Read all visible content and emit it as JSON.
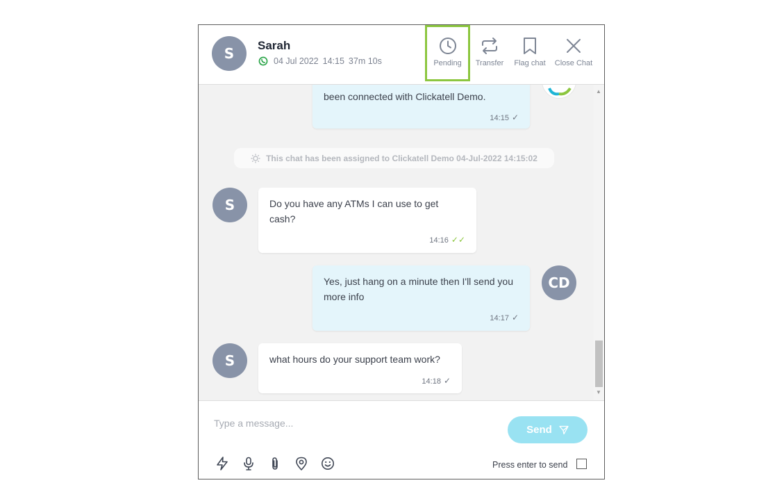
{
  "header": {
    "avatar_initial": "S",
    "name": "Sarah",
    "date": "04 Jul 2022",
    "time": "14:15",
    "duration": "37m 10s",
    "channel_icon": "whatsapp-icon",
    "actions": [
      {
        "label": "Pending",
        "icon": "clock-icon"
      },
      {
        "label": "Transfer",
        "icon": "transfer-arrows-icon"
      },
      {
        "label": "Flag chat",
        "icon": "bookmark-icon"
      },
      {
        "label": "Close Chat",
        "icon": "close-icon"
      }
    ]
  },
  "messages": [
    {
      "direction": "out",
      "text": "been connected with Clickatell Demo.",
      "time": "14:15",
      "status": "sent"
    },
    {
      "direction": "in",
      "avatar": "S",
      "text": "Do you have any ATMs I can use to get cash?",
      "time": "14:16",
      "status": "read"
    },
    {
      "direction": "out",
      "avatar": "CD",
      "text": "Yes, just hang on a minute then I'll send you more info",
      "time": "14:17",
      "status": "sent"
    },
    {
      "direction": "in",
      "avatar": "S",
      "text": "what hours do your support team work?",
      "time": "14:18",
      "status": "sent"
    }
  ],
  "system_note": "This chat has been assigned to Clickatell Demo 04-Jul-2022 14:15:02",
  "composer": {
    "placeholder": "Type a message...",
    "send_label": "Send",
    "enter_to_send_label": "Press enter to send",
    "tools": [
      "lightning-icon",
      "microphone-icon",
      "paperclip-icon",
      "location-pin-icon",
      "emoji-icon"
    ]
  },
  "colors": {
    "accent_green": "#8cc63f",
    "avatar_gray": "#8893a8",
    "send_button": "#99e2f2",
    "outgoing_bubble": "#e4f5fb"
  },
  "tick_glyph": "✓",
  "double_tick_glyph": "✓✓"
}
